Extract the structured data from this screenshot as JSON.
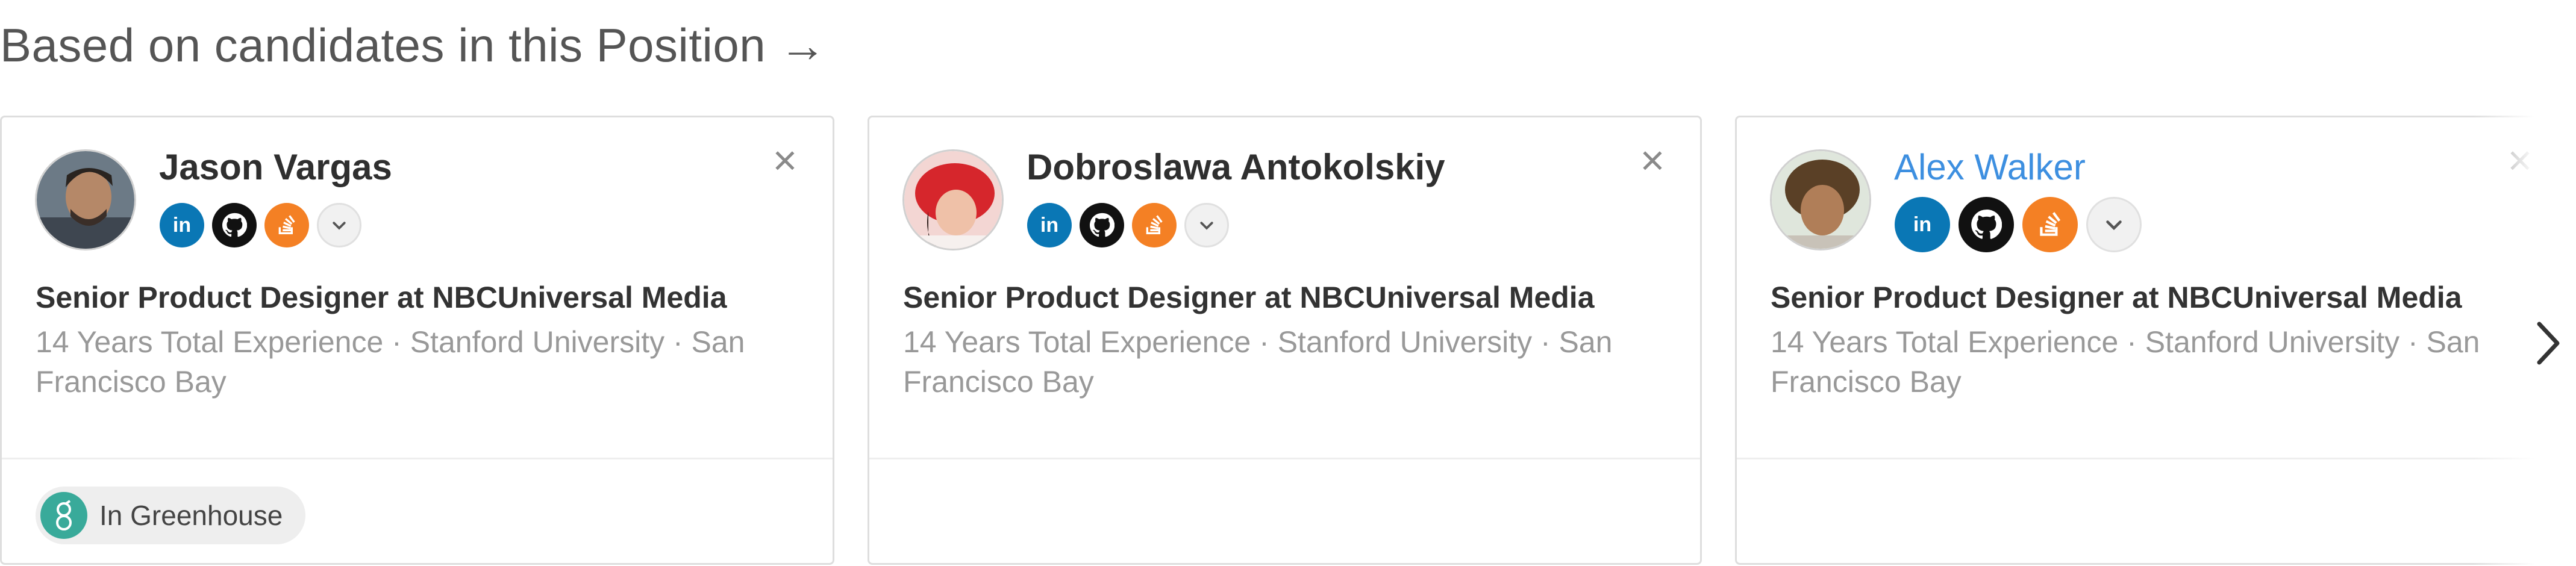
{
  "heading": "Based on candidates in this Position →",
  "cards": [
    {
      "name": "Jason Vargas",
      "title": "Senior Product Designer at NBCUniversal Media",
      "meta": "14 Years Total Experience ·  Stanford University ·  San Francisco Bay",
      "status": "In Greenhouse"
    },
    {
      "name": "Dobroslawa Antokolskiy",
      "title": "Senior Product Designer at NBCUniversal Media",
      "meta": "14 Years Total Experience ·  Stanford University ·  San Francisco Bay"
    },
    {
      "name": "Alex Walker",
      "title": "Senior Product Designer at NBCUniversal Media",
      "meta": "14 Years Total Experience ·  Stanford University ·  San Francisco Bay"
    }
  ],
  "icons": {
    "linkedin": "in",
    "close": "×"
  },
  "colors": {
    "linkedin": "#0a77b5",
    "github": "#111111",
    "stackoverflow": "#f48024",
    "greenhouse": "#39aa9a",
    "link": "#3d8fe0"
  }
}
